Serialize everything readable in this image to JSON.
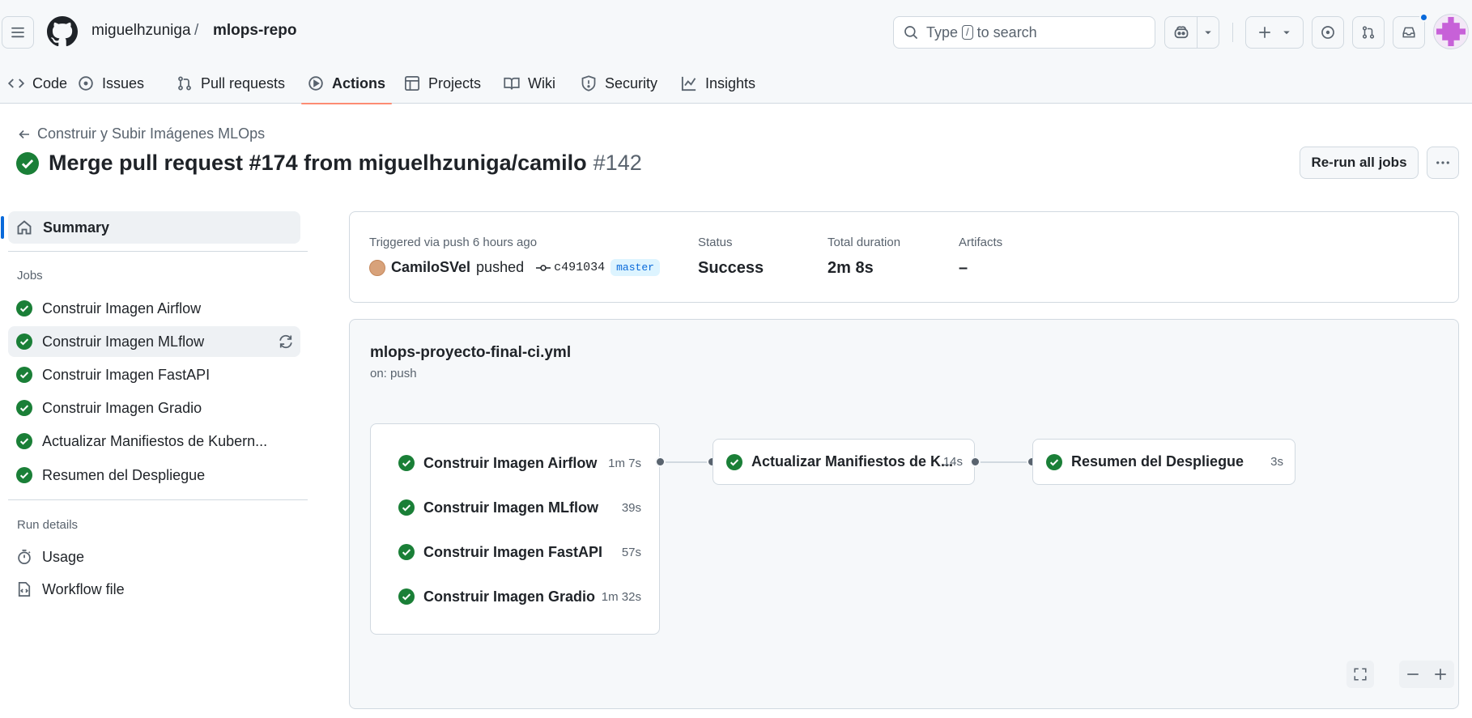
{
  "header": {
    "owner": "miguelhzuniga",
    "separator": "/",
    "repo": "mlops-repo",
    "search": {
      "prefix": "Type",
      "key": "/",
      "suffix": "to search"
    }
  },
  "tabs": [
    {
      "label": "Code",
      "icon": "code-icon"
    },
    {
      "label": "Issues",
      "icon": "issue-icon"
    },
    {
      "label": "Pull requests",
      "icon": "pull-request-icon"
    },
    {
      "label": "Actions",
      "icon": "play-icon",
      "active": true
    },
    {
      "label": "Projects",
      "icon": "table-icon"
    },
    {
      "label": "Wiki",
      "icon": "book-icon"
    },
    {
      "label": "Security",
      "icon": "shield-icon"
    },
    {
      "label": "Insights",
      "icon": "graph-icon"
    }
  ],
  "page": {
    "back_label": "Construir y Subir Imágenes MLOps",
    "title": "Merge pull request #174 from miguelhzuniga/camilo",
    "run_number": "#142",
    "rerun_label": "Re-run all jobs"
  },
  "sidebar": {
    "summary_label": "Summary",
    "jobs_heading": "Jobs",
    "jobs": [
      "Construir Imagen Airflow",
      "Construir Imagen MLflow",
      "Construir Imagen FastAPI",
      "Construir Imagen Gradio",
      "Actualizar Manifiestos de Kubern...",
      "Resumen del Despliegue"
    ],
    "details_heading": "Run details",
    "usage_label": "Usage",
    "workflow_file_label": "Workflow file"
  },
  "summary": {
    "triggered_label": "Triggered via push 6 hours ago",
    "actor": "CamiloSVel",
    "action": "pushed",
    "commit": "c491034",
    "branch": "master",
    "status_label": "Status",
    "status_value": "Success",
    "duration_label": "Total duration",
    "duration_value": "2m 8s",
    "artifacts_label": "Artifacts",
    "artifacts_value": "–"
  },
  "workflow": {
    "file": "mlops-proyecto-final-ci.yml",
    "trigger": "on: push",
    "build_jobs": [
      {
        "name": "Construir Imagen Airflow",
        "duration": "1m 7s"
      },
      {
        "name": "Construir Imagen MLflow",
        "duration": "39s"
      },
      {
        "name": "Construir Imagen FastAPI",
        "duration": "57s"
      },
      {
        "name": "Construir Imagen Gradio",
        "duration": "1m 32s"
      }
    ],
    "update_job": {
      "name": "Actualizar Manifiestos de K...",
      "duration": "14s"
    },
    "summary_job": {
      "name": "Resumen del Despliegue",
      "duration": "3s"
    }
  },
  "colors": {
    "success": "#1a7f37",
    "accent_tab": "#fd8c73",
    "link": "#0969da"
  }
}
